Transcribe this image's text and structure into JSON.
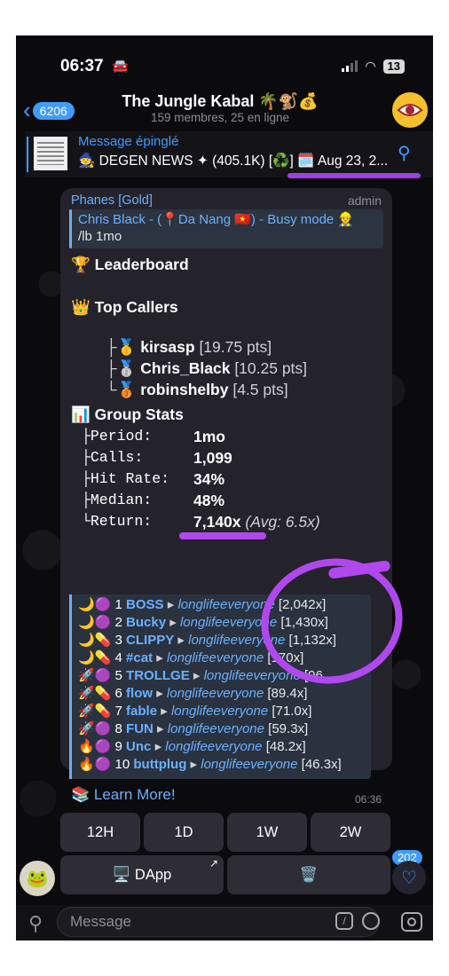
{
  "status": {
    "time": "06:37",
    "car": "🚘",
    "battery": "13"
  },
  "header": {
    "back_count": "6206",
    "title": "The Jungle Kabal 🌴🐒💰",
    "subtitle": "159 membres, 25 en ligne",
    "avatar_icon": "eye-logo"
  },
  "pinned": {
    "label": "Message épinglé",
    "text": "🧙 DEGEN NEWS ✦ (405.1K) [♻️] 🗓️ Aug 23, 2..."
  },
  "message": {
    "sender": "Phanes [Gold]",
    "role": "admin",
    "reply_name": "Chris Black - (📍Da Nang 🇻🇳) - Busy mode 👷",
    "reply_text": "/lb 1mo",
    "leaderboard": "🏆 Leaderboard",
    "top_callers": "👑 Top Callers",
    "callers": [
      {
        "prefix": "├🥇",
        "name": "kirsasp",
        "pts": "[19.75 pts]"
      },
      {
        "prefix": "├🥈",
        "name": "Chris_Black",
        "pts": "[10.25 pts]"
      },
      {
        "prefix": "└🥉",
        "name": "robinshelby",
        "pts": "[4.5 pts]"
      }
    ],
    "group_stats": "📊 Group Stats",
    "stats": [
      {
        "label": "├Period:",
        "value": "1mo",
        "extra": ""
      },
      {
        "label": "├Calls:",
        "value": "1,099",
        "extra": ""
      },
      {
        "label": "├Hit Rate:",
        "value": "34%",
        "extra": ""
      },
      {
        "label": "├Median:",
        "value": "48%",
        "extra": ""
      },
      {
        "label": "└Return:",
        "value": "7,140x",
        "extra": "(Avg: 6.5x)"
      }
    ],
    "ranking": [
      {
        "icons": "🌙🟣",
        "rank": "1",
        "name": "BOSS",
        "by": "longlifeeveryone",
        "mult": "[2,042x]"
      },
      {
        "icons": "🌙🟣",
        "rank": "2",
        "name": "Bucky",
        "by": "longlifeeveryone",
        "mult": "[1,430x]"
      },
      {
        "icons": "🌙💊",
        "rank": "3",
        "name": "CLIPPY",
        "by": "longlifeeveryone",
        "mult": "[1,132x]"
      },
      {
        "icons": "🌙💊",
        "rank": "4",
        "name": "#cat",
        "by": "longlifeeveryone",
        "mult": "[170x]"
      },
      {
        "icons": "🚀🟣",
        "rank": "5",
        "name": "TROLLGE",
        "by": "longlifeeveryone",
        "mult": "[96..."
      },
      {
        "icons": "🚀💊",
        "rank": "6",
        "name": "flow",
        "by": "longlifeeveryone",
        "mult": "[89.4x]"
      },
      {
        "icons": "🚀💊",
        "rank": "7",
        "name": "fable",
        "by": "longlifeeveryone",
        "mult": "[71.0x]"
      },
      {
        "icons": "🚀🟣",
        "rank": "8",
        "name": "FUN",
        "by": "longlifeeveryone",
        "mult": "[59.3x]"
      },
      {
        "icons": "🔥🟣",
        "rank": "9",
        "name": "Unc",
        "by": "longlifeeveryone",
        "mult": "[48.2x]"
      },
      {
        "icons": "🔥🟣",
        "rank": "10",
        "name": "buttplug",
        "by": "longlifeeveryone",
        "mult": "[46.3x]"
      }
    ],
    "learn_more": "📚 Learn More!",
    "time": "06:36"
  },
  "keyboard": {
    "row1": [
      "12H",
      "1D",
      "1W",
      "2W"
    ],
    "dapp": "🖥️ DApp",
    "trash": "🗑️"
  },
  "fab_badge": "202",
  "input": {
    "placeholder": "Message"
  },
  "colors": {
    "accent": "#3f9bff",
    "marker": "#b048ee",
    "bubble": "#24232c"
  }
}
